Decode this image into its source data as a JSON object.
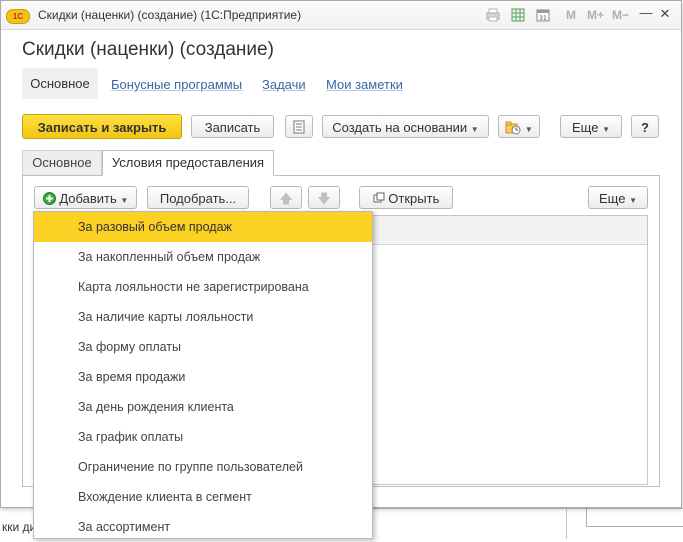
{
  "window": {
    "app_logo": "1С",
    "title": "Скидки (наценки) (создание)  (1С:Предприятие)",
    "titlebar_m_buttons": [
      "M",
      "M+",
      "M−"
    ],
    "minimize": "—",
    "maximize": "□",
    "close": "✕"
  },
  "form": {
    "title": "Скидки (наценки) (создание)"
  },
  "nav": {
    "active": "Основное",
    "links": [
      "Бонусные программы",
      "Задачи",
      "Мои заметки"
    ]
  },
  "toolbar": {
    "save_close": "Записать и закрыть",
    "save": "Записать",
    "create_based": "Создать на основании",
    "more": "Еще",
    "help": "?"
  },
  "tabs": {
    "main": "Основное",
    "conditions": "Условия предоставления"
  },
  "table_toolbar": {
    "add": "Добавить",
    "pick": "Подобрать...",
    "open": "Открыть",
    "more": "Еще"
  },
  "menu": {
    "items": [
      "За разовый объем продаж",
      "За накопленный объем продаж",
      "Карта лояльности не зарегистрирована",
      "За наличие карты лояльности",
      "За форму оплаты",
      "За время продажи",
      "За день рождения клиента",
      "За график оплаты",
      "Ограничение по группе пользователей",
      "Вхождение клиента в сегмент",
      "За ассортимент"
    ],
    "highlighted_index": 0
  },
  "background": {
    "text_fragment": "кки ди"
  },
  "colors": {
    "accent_yellow": "#fbd224",
    "link_blue": "#3966a8",
    "add_icon_green": "#3aa83a"
  }
}
